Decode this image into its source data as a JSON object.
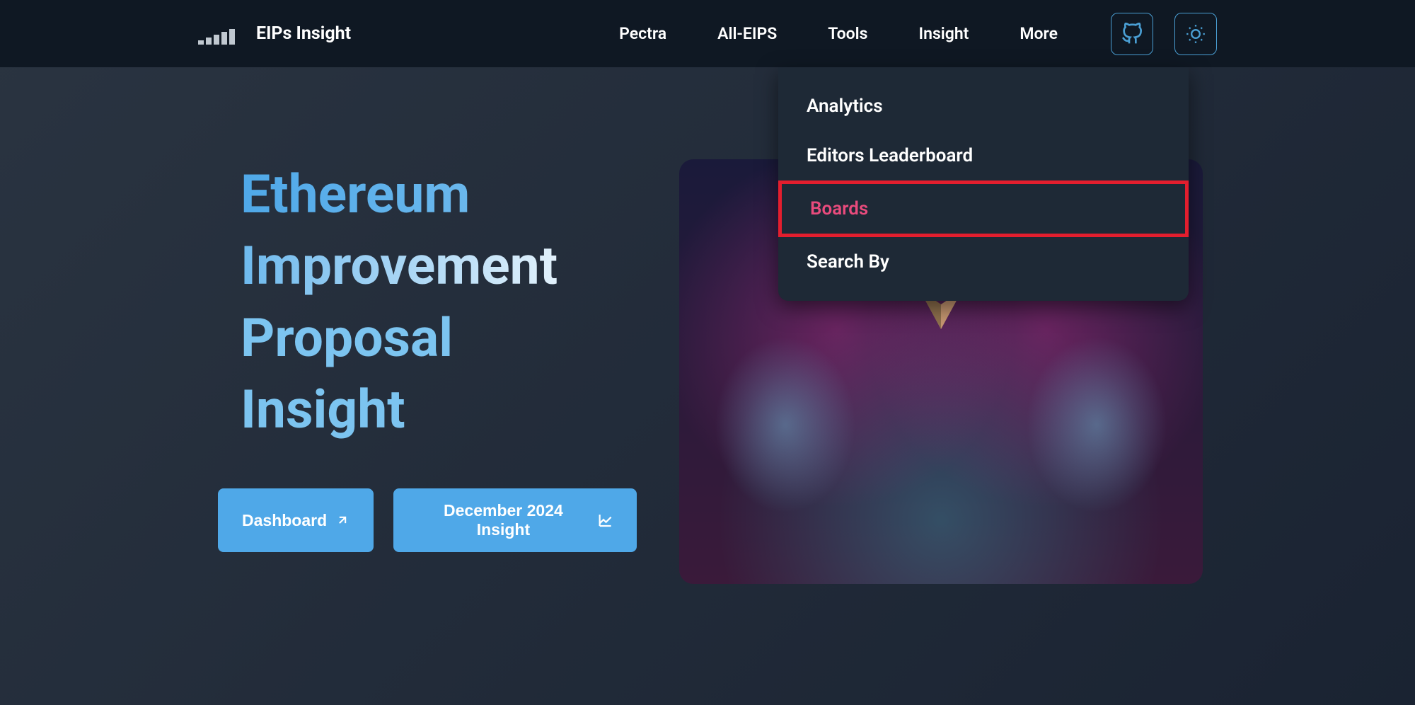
{
  "header": {
    "logo_text": "EIPs Insight",
    "nav": {
      "items": [
        {
          "label": "Pectra"
        },
        {
          "label": "All-EIPS"
        },
        {
          "label": "Tools"
        },
        {
          "label": "Insight"
        },
        {
          "label": "More"
        }
      ]
    },
    "icons": {
      "github": "github-icon",
      "theme": "sun-icon"
    }
  },
  "dropdown": {
    "items": [
      {
        "label": "Analytics",
        "highlighted": false
      },
      {
        "label": "Editors Leaderboard",
        "highlighted": false
      },
      {
        "label": "Boards",
        "highlighted": true
      },
      {
        "label": "Search By",
        "highlighted": false
      }
    ]
  },
  "hero": {
    "title_words": {
      "word1": "Ethereum",
      "word2": "Improvement",
      "word3": "Proposal",
      "word4": "Insight"
    },
    "buttons": {
      "dashboard": "Dashboard",
      "insight": "December 2024 Insight"
    }
  }
}
